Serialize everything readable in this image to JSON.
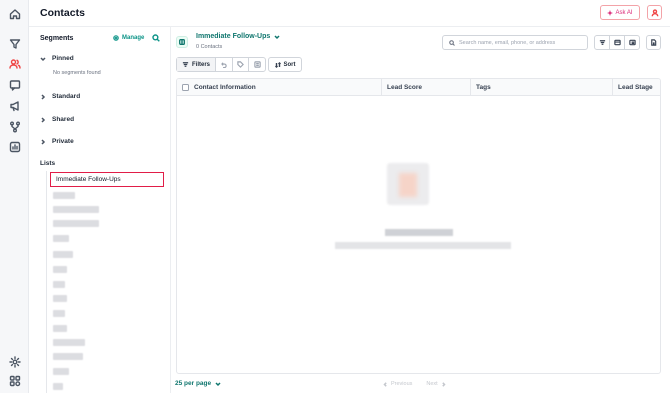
{
  "rail": {
    "items": [
      {
        "name": "home-icon",
        "active": false
      },
      {
        "name": "funnel-icon",
        "active": false
      },
      {
        "name": "contacts-icon",
        "active": true
      },
      {
        "name": "conversations-icon",
        "active": false
      },
      {
        "name": "megaphone-icon",
        "active": false
      },
      {
        "name": "workflow-icon",
        "active": false
      },
      {
        "name": "chart-icon",
        "active": false
      },
      {
        "name": "settings-icon",
        "active": false
      },
      {
        "name": "apps-icon",
        "active": false
      }
    ]
  },
  "header": {
    "title": "Contacts",
    "ask_ai_label": "Ask AI"
  },
  "segments": {
    "title": "Segments",
    "manage_label": "Manage",
    "groups": {
      "pinned": "Pinned",
      "standard": "Standard",
      "shared": "Shared",
      "private": "Private"
    },
    "pinned_empty": "No segments found",
    "lists_label": "Lists",
    "selected_list": "Immediate Follow-Ups"
  },
  "main": {
    "list_name": "Immediate Follow-Ups",
    "contact_count": "0 Contacts",
    "search_placeholder": "Search name, email, phone, or address",
    "filters_label": "Filters",
    "sort_label": "Sort",
    "columns": [
      "Contact Information",
      "Lead Score",
      "Tags",
      "Lead Stage"
    ],
    "per_page": "25 per page",
    "prev_label": "Previous",
    "next_label": "Next"
  },
  "colors": {
    "accent": "#0f766e",
    "brand_red": "#ef4444"
  }
}
